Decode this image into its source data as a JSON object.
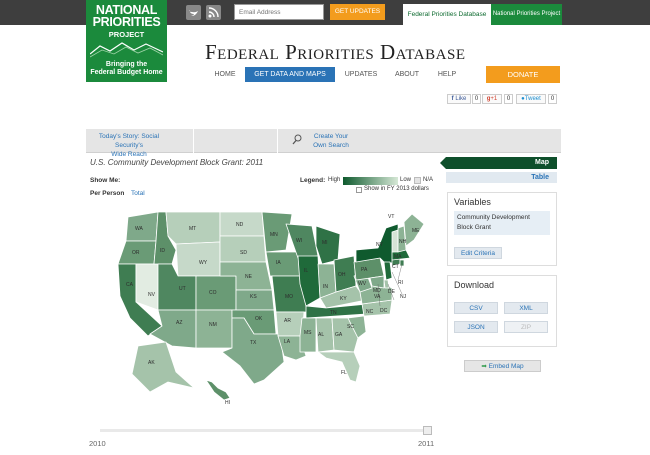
{
  "header": {
    "logo": {
      "line1": "NATIONAL",
      "line2": "PRIORITIES",
      "line3": "PROJECT",
      "tagline1": "Bringing the",
      "tagline2": "Federal Budget Home"
    },
    "email_placeholder": "Email Address",
    "get_updates_label": "GET UPDATES",
    "site_tabs": [
      "Federal Priorities Database",
      "National Priorities Project"
    ],
    "title": "Federal Priorities Database"
  },
  "nav": {
    "items": [
      "HOME",
      "GET DATA AND MAPS",
      "UPDATES",
      "ABOUT",
      "HELP"
    ],
    "active": "GET DATA AND MAPS",
    "donate_label": "DONATE"
  },
  "share": {
    "facebook_label": "Like",
    "facebook_count": "0",
    "google_label": "+1",
    "google_count": "0",
    "twitter_label": "Tweet",
    "twitter_count": "0"
  },
  "story_bar": {
    "item1_line1": "Today's Story: Social Security's",
    "item1_line2": "Wide Reach",
    "item2_line1": "Create Your",
    "item2_line2": "Own Search"
  },
  "map": {
    "subtitle": "U.S. Community Development Block Grant: 2011",
    "show_me_label": "Show Me:",
    "per_person_label": "Per Person",
    "total_label": "Total",
    "legend_label": "Legend:",
    "legend_high": "High",
    "legend_low": "Low",
    "legend_na": "N/A",
    "fy_dollars_label": "Show in FY 2013 dollars",
    "colors": {
      "high": "#0f5a2e",
      "low": "#d6e8d6",
      "na": "#e4e4e4"
    },
    "states": [
      "WA",
      "OR",
      "CA",
      "NV",
      "ID",
      "MT",
      "WY",
      "UT",
      "AZ",
      "CO",
      "NM",
      "ND",
      "SD",
      "NE",
      "KS",
      "OK",
      "TX",
      "MN",
      "IA",
      "MO",
      "AR",
      "LA",
      "WI",
      "IL",
      "MI",
      "IN",
      "OH",
      "KY",
      "TN",
      "MS",
      "AL",
      "GA",
      "FL",
      "SC",
      "NC",
      "VA",
      "WV",
      "PA",
      "NY",
      "VT",
      "NH",
      "ME",
      "MA",
      "RI",
      "CT",
      "NJ",
      "DE",
      "MD",
      "DC",
      "AK",
      "HI"
    ]
  },
  "sidebar": {
    "view_map_label": "Map",
    "view_table_label": "Table",
    "variables_title": "Variables",
    "variable_name": "Community Development Block Grant",
    "edit_criteria_label": "Edit Criteria",
    "download_title": "Download",
    "download": {
      "csv": "CSV",
      "xml": "XML",
      "json": "JSON",
      "zip": "ZIP"
    },
    "embed_label": "Embed Map"
  },
  "timeline": {
    "start_year": "2010",
    "end_year": "2011",
    "selected_fraction": 1.0
  }
}
